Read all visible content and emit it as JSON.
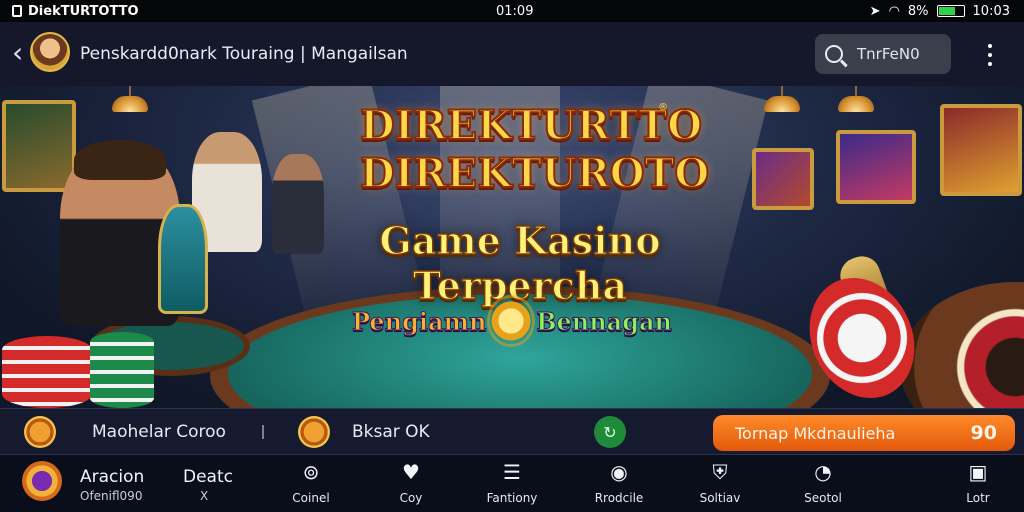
{
  "status_bar": {
    "app_name": "DiekTURTOTTO",
    "time_center": "01:09",
    "battery": "8%",
    "time_right": "10:03"
  },
  "header": {
    "title": "Penskardd0nark Touraing | Mangailsan",
    "search_label": "TnrFeN0"
  },
  "banner": {
    "logo_line1": "DIREKTURTTO",
    "logo_line2": "DIREKTUROTO",
    "trademark": "®",
    "headline": "Game Kasino Terpercha",
    "tagline_left": "Pengiamn",
    "tagline_right": "Bennagan"
  },
  "info_bar": {
    "left_label": "Maohelar Coroo",
    "mid_label": "Bksar OK",
    "promo_label": "Tornap Mkdnaulieha",
    "promo_value": "90"
  },
  "bottom_nav": {
    "user_name": "Aracion",
    "user_sub": "Ofenifl090",
    "deats_label": "Deatc",
    "deats_sub": "X",
    "items": [
      {
        "label": "Coinel",
        "icon": "wallet-icon"
      },
      {
        "label": "Coy",
        "icon": "heart-icon"
      },
      {
        "label": "Fantiony",
        "icon": "list-icon"
      },
      {
        "label": "Rrodcile",
        "icon": "eye-icon"
      },
      {
        "label": "Soltiav",
        "icon": "shield-icon"
      },
      {
        "label": "Seotol",
        "icon": "chat-icon"
      },
      {
        "label": "Lotr",
        "icon": "settings-icon"
      }
    ]
  },
  "colors": {
    "accent_orange": "#e25a0a",
    "header_bg": "#14182a",
    "logo_gold": "#ffd84a"
  }
}
